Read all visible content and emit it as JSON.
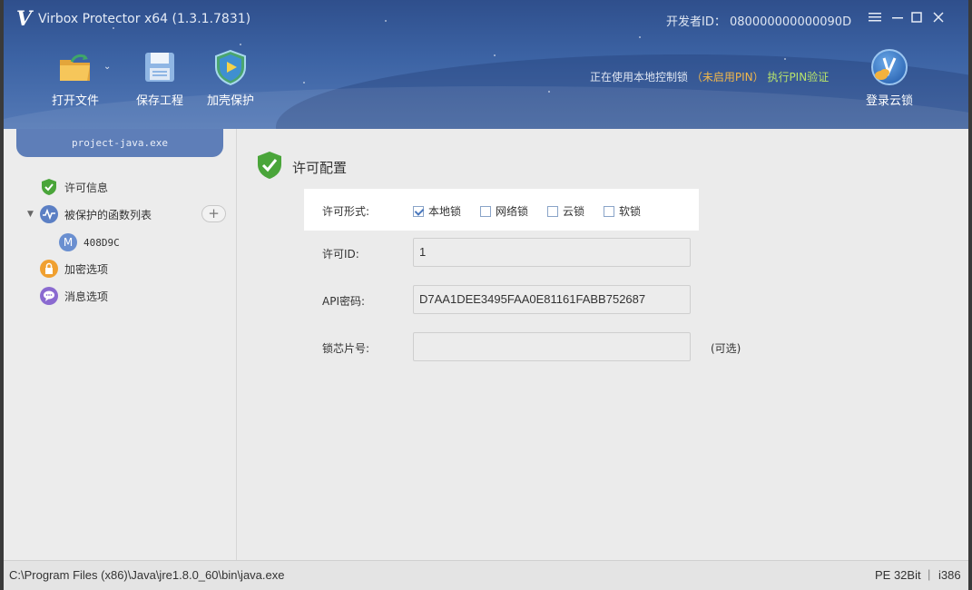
{
  "app": {
    "logo": "V",
    "title": "Virbox Protector x64  (1.3.1.7831)",
    "developer_label": "开发者ID：",
    "developer_id": "080000000000090D"
  },
  "window_controls": [
    "menu-icon",
    "minimize-icon",
    "maximize-icon",
    "close-icon"
  ],
  "toolbar": {
    "open_file": "打开文件",
    "save_project": "保存工程",
    "shell_protect": "加壳保护"
  },
  "lock_status": {
    "text": "正在使用本地控制锁",
    "pin_state": "（未启用PIN）",
    "verify_link": "执行PIN验证"
  },
  "cloud": {
    "label": "登录云锁"
  },
  "sidebar": {
    "project": "project-java.exe",
    "items": [
      {
        "label": "许可信息",
        "icon": "shield-check-icon"
      },
      {
        "label": "被保护的函数列表",
        "icon": "waveform-icon"
      },
      {
        "label": "408D9C",
        "icon": "method-m-icon",
        "badge": "M"
      },
      {
        "label": "加密选项",
        "icon": "lock-icon"
      },
      {
        "label": "消息选项",
        "icon": "message-icon"
      }
    ],
    "add_symbol": "+"
  },
  "main": {
    "section_title": "许可配置",
    "license_type_label": "许可形式:",
    "license_types": [
      {
        "label": "本地锁",
        "checked": true
      },
      {
        "label": "网络锁",
        "checked": false
      },
      {
        "label": "云锁",
        "checked": false
      },
      {
        "label": "软锁",
        "checked": false
      }
    ],
    "license_id_label": "许可ID:",
    "license_id_value": "1",
    "api_key_label": "API密码:",
    "api_key_value": "D7AA1DEE3495FAA0E81161FABB752687",
    "chip_label": "锁芯片号:",
    "chip_value": "",
    "optional_note": "(可选)"
  },
  "statusbar": {
    "path": "C:\\Program Files (x86)\\Java\\jre1.8.0_60\\bin\\java.exe",
    "arch": "PE 32Bit",
    "separator": "|",
    "cpu": "i386"
  },
  "colors": {
    "header": "#3c63a4",
    "accent": "#5e7eb8",
    "pin_warning": "#f2b84b",
    "verify": "#b7e36b"
  }
}
